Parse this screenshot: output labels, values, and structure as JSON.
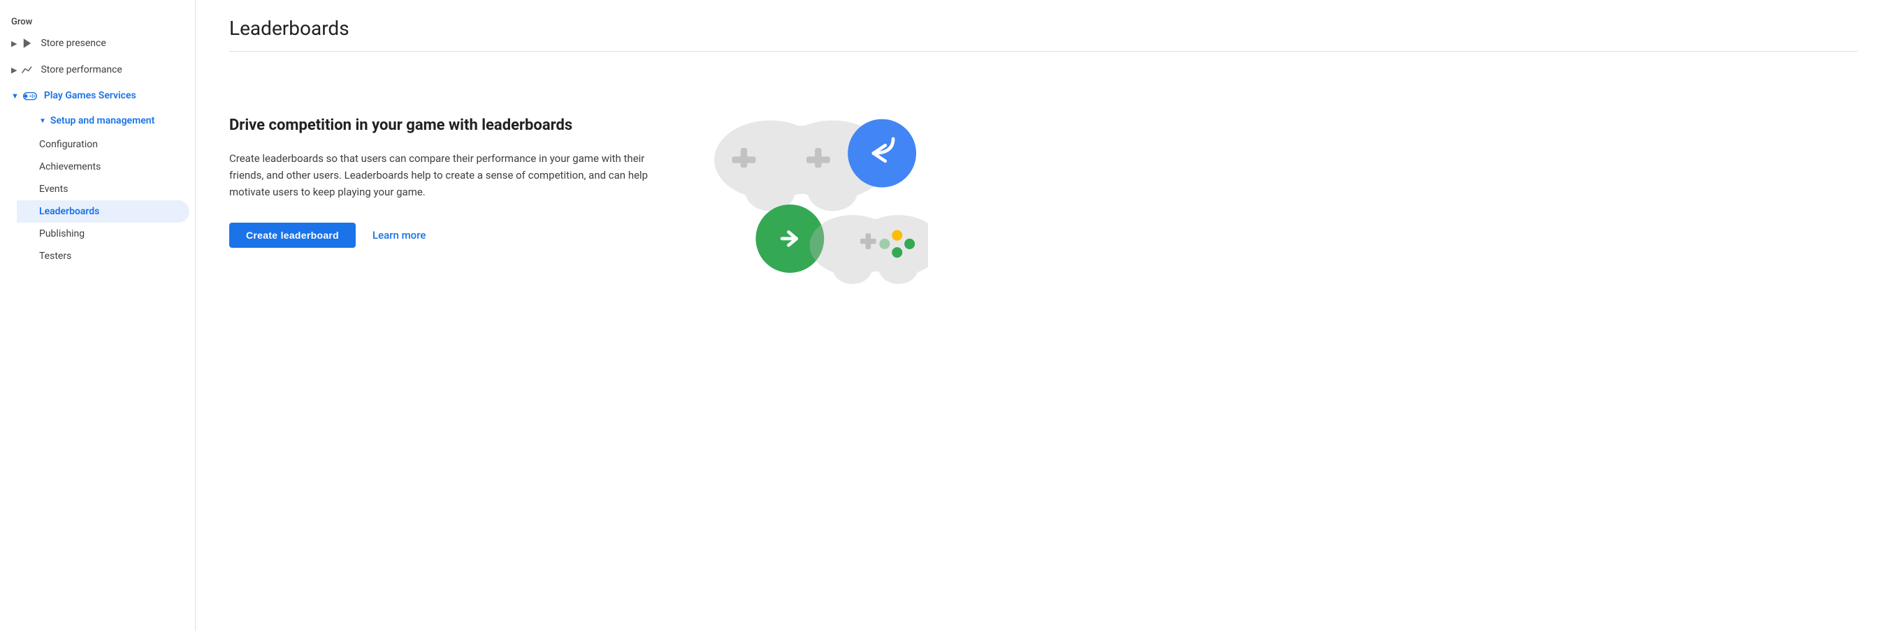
{
  "sidebar": {
    "grow_label": "Grow",
    "items": [
      {
        "id": "store-presence",
        "label": "Store presence",
        "icon": "play-icon",
        "indent": 0,
        "expanded": false,
        "active": false,
        "blue": false
      },
      {
        "id": "store-performance",
        "label": "Store performance",
        "icon": "trend-icon",
        "indent": 0,
        "expanded": false,
        "active": false,
        "blue": false
      },
      {
        "id": "play-games-services",
        "label": "Play Games Services",
        "icon": "gamepad-icon",
        "indent": 0,
        "expanded": true,
        "active": false,
        "blue": true
      }
    ],
    "sub_section": {
      "label": "Setup and management",
      "items": [
        {
          "id": "configuration",
          "label": "Configuration",
          "active": false
        },
        {
          "id": "achievements",
          "label": "Achievements",
          "active": false
        },
        {
          "id": "events",
          "label": "Events",
          "active": false
        },
        {
          "id": "leaderboards",
          "label": "Leaderboards",
          "active": true
        },
        {
          "id": "publishing",
          "label": "Publishing",
          "active": false
        },
        {
          "id": "testers",
          "label": "Testers",
          "active": false
        }
      ]
    }
  },
  "page": {
    "title": "Leaderboards",
    "content_heading": "Drive competition in your game with leaderboards",
    "content_body": "Create leaderboards so that users can compare their performance in your game with their friends, and other users. Leaderboards help to create a sense of competition, and can help motivate users to keep playing your game.",
    "create_button_label": "Create leaderboard",
    "learn_more_label": "Learn more"
  }
}
